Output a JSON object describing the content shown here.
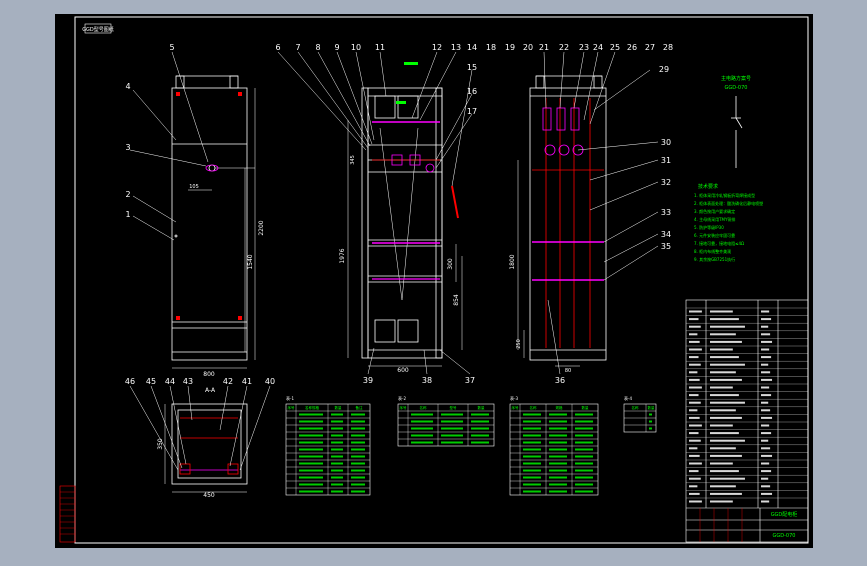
{
  "frame_tag": "GGD型号图纸",
  "views": {
    "front": {
      "width_dim": "800",
      "height_dim": "2200",
      "sub_dim": "1540",
      "handle_dim": "105",
      "callouts": [
        "1",
        "2",
        "3",
        "4",
        "5"
      ]
    },
    "interior": {
      "width_dim": "600",
      "h1": "1976",
      "h2": "300",
      "h3": "854",
      "h4": "345",
      "callouts_top": [
        "6",
        "7",
        "8",
        "9",
        "10",
        "11",
        "12",
        "13",
        "14",
        "18",
        "19",
        "20"
      ],
      "callouts_bottom": [
        "39",
        "38",
        "37"
      ],
      "side_callouts": [
        "15",
        "16",
        "17"
      ]
    },
    "rear": {
      "dim1": "1800",
      "dim2": "250",
      "dim3": "80",
      "callouts_top": [
        "21",
        "22",
        "23",
        "24",
        "25",
        "26",
        "27",
        "28"
      ],
      "callouts_right": [
        "29",
        "30",
        "31",
        "32",
        "33",
        "34",
        "35"
      ],
      "bottom_callout": "36"
    },
    "plan": {
      "title": "A-A",
      "width_dim": "450",
      "depth_dim": "350",
      "callouts": [
        "46",
        "45",
        "44",
        "43",
        "42",
        "41",
        "40"
      ]
    }
  },
  "schematic": {
    "title": "主电路方案号",
    "subtitle": "GGD-070"
  },
  "tech_notes": {
    "title": "技术要求",
    "lines": [
      "1. 柜体采用冷轧钢板折弯焊接成型",
      "2. 柜体表面处理：酸洗磷化后静电喷塑",
      "3. 颜色按用户要求确定",
      "4. 主母线采用TMY铜排",
      "5. 防护等级IP30",
      "6. 元件安装应牢固可靠",
      "7. 接地可靠，接地电阻≤4Ω",
      "8. 柜内布线整齐美观",
      "9. 其余按GB7251执行"
    ]
  },
  "tables": [
    {
      "label": "表-1",
      "headers": [
        "序号",
        "名称规格",
        "数量",
        "备注"
      ],
      "rows": 12
    },
    {
      "label": "表-2",
      "headers": [
        "序号",
        "名称",
        "型号",
        "数量"
      ],
      "rows": 5
    },
    {
      "label": "表-3",
      "headers": [
        "序号",
        "名称",
        "规格",
        "数量"
      ],
      "rows": 12
    },
    {
      "label": "表-4",
      "headers": [
        "名称",
        "数量"
      ],
      "rows": 3
    }
  ],
  "title_block": {
    "title": "GGD配电柜",
    "drawing_no": "GGD-070"
  },
  "colors": {
    "background": "#000000",
    "outer": "#a6b0bf",
    "line": "#ffffff",
    "accent": "#ff00ff",
    "text": "#00ff00",
    "mark": "#ff0000"
  }
}
